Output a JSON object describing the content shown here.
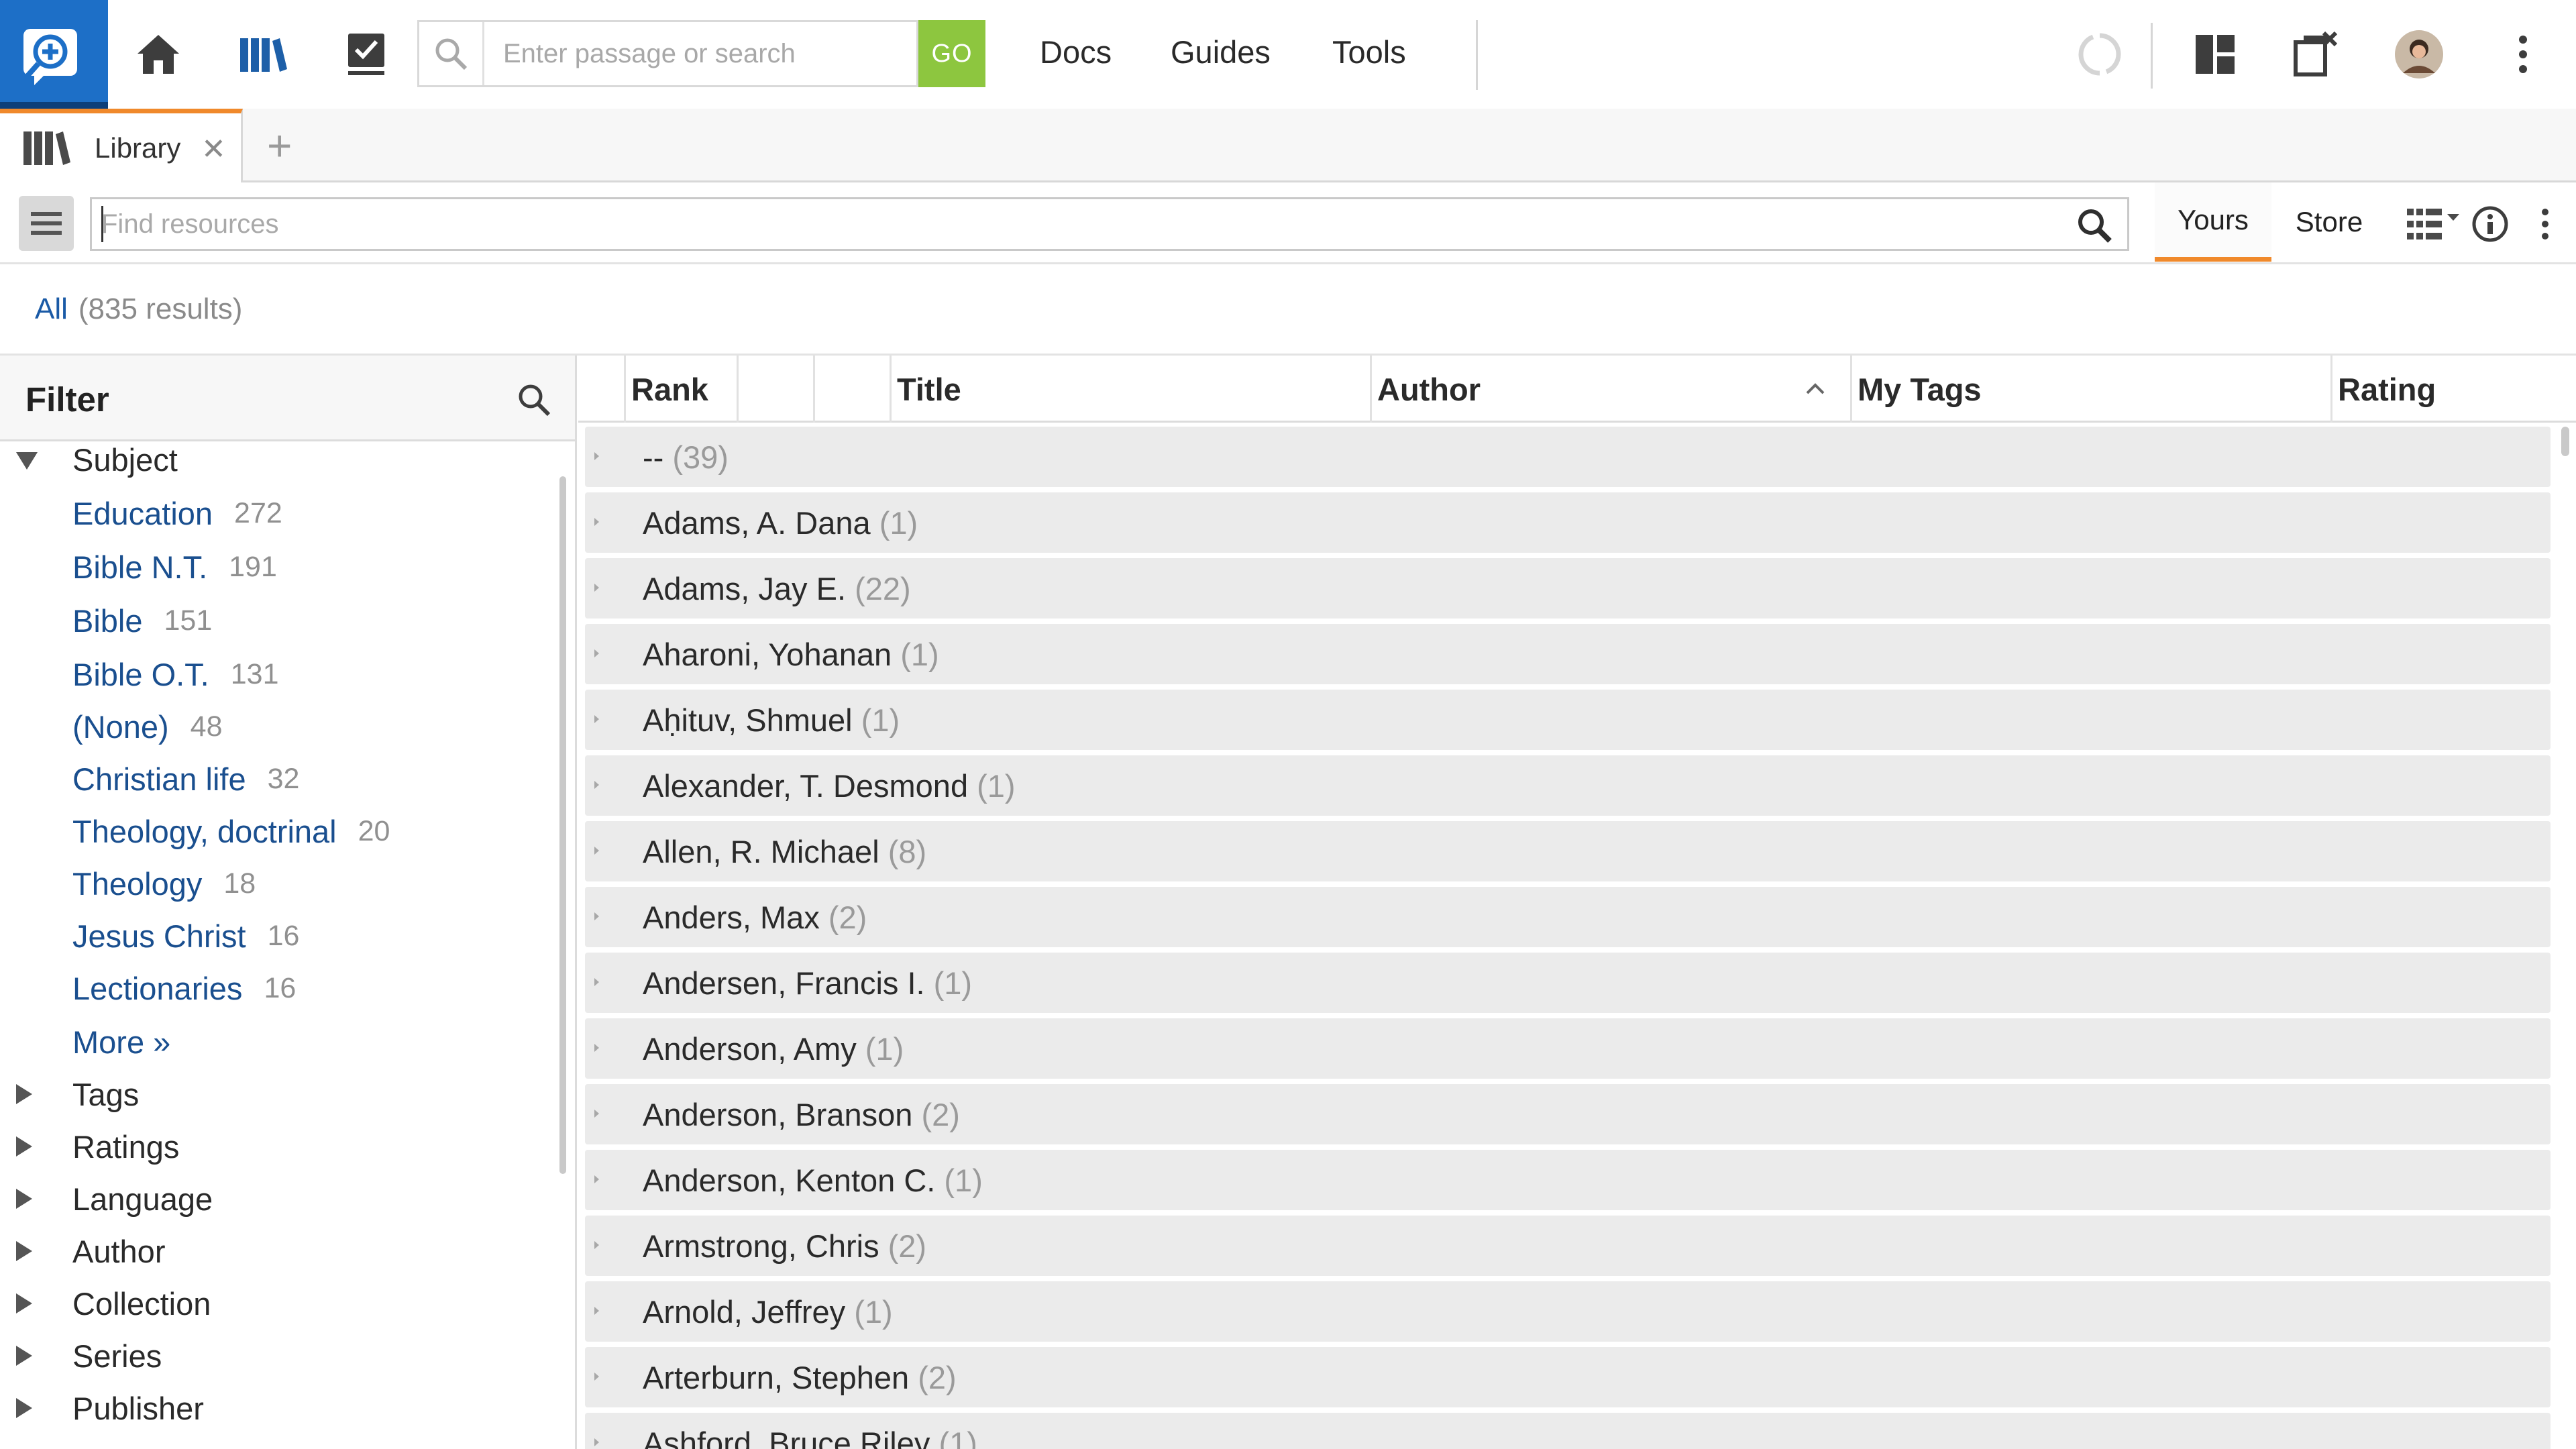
{
  "toolbar": {
    "search_placeholder": "Enter passage or search",
    "go_label": "GO",
    "nav_links": [
      "Docs",
      "Guides",
      "Tools"
    ]
  },
  "tabs": {
    "library_label": "Library",
    "close_glyph": "✕",
    "add_glyph": "+"
  },
  "library": {
    "find_placeholder": "Find resources",
    "yours_label": "Yours",
    "store_label": "Store",
    "all_label": "All",
    "results_count": "(835 results)"
  },
  "filter": {
    "title": "Filter",
    "subject_label": "Subject",
    "subjects": [
      {
        "name": "Education",
        "count": "272"
      },
      {
        "name": "Bible N.T.",
        "count": "191"
      },
      {
        "name": "Bible",
        "count": "151"
      },
      {
        "name": "Bible O.T.",
        "count": "131"
      },
      {
        "name": "(None)",
        "count": "48"
      },
      {
        "name": "Christian life",
        "count": "32"
      },
      {
        "name": "Theology, doctrinal",
        "count": "20"
      },
      {
        "name": "Theology",
        "count": "18"
      },
      {
        "name": "Jesus Christ",
        "count": "16"
      },
      {
        "name": "Lectionaries",
        "count": "16"
      }
    ],
    "more_label": "More »",
    "facets": [
      "Tags",
      "Ratings",
      "Language",
      "Author",
      "Collection",
      "Series",
      "Publisher"
    ]
  },
  "table": {
    "columns": {
      "rank": "Rank",
      "title": "Title",
      "author": "Author",
      "my_tags": "My Tags",
      "rating": "Rating"
    },
    "groups": [
      {
        "name": "--",
        "count": "(39)"
      },
      {
        "name": "Adams, A. Dana",
        "count": "(1)"
      },
      {
        "name": "Adams, Jay E.",
        "count": "(22)"
      },
      {
        "name": "Aharoni, Yohanan",
        "count": "(1)"
      },
      {
        "name": "Aḥituv, Shmuel",
        "count": "(1)"
      },
      {
        "name": "Alexander, T. Desmond",
        "count": "(1)"
      },
      {
        "name": "Allen, R. Michael",
        "count": "(8)"
      },
      {
        "name": "Anders, Max",
        "count": "(2)"
      },
      {
        "name": "Andersen, Francis I.",
        "count": "(1)"
      },
      {
        "name": "Anderson, Amy",
        "count": "(1)"
      },
      {
        "name": "Anderson, Branson",
        "count": "(2)"
      },
      {
        "name": "Anderson, Kenton C.",
        "count": "(1)"
      },
      {
        "name": "Armstrong, Chris",
        "count": "(2)"
      },
      {
        "name": "Arnold, Jeffrey",
        "count": "(1)"
      },
      {
        "name": "Arterburn, Stephen",
        "count": "(2)"
      },
      {
        "name": "Ashford, Bruce Riley",
        "count": "(1)"
      }
    ]
  },
  "colors": {
    "brand_blue": "#1d6fc7",
    "go_green": "#8dc63f",
    "accent_orange": "#f0892b",
    "link_blue": "#1a4f8f"
  }
}
